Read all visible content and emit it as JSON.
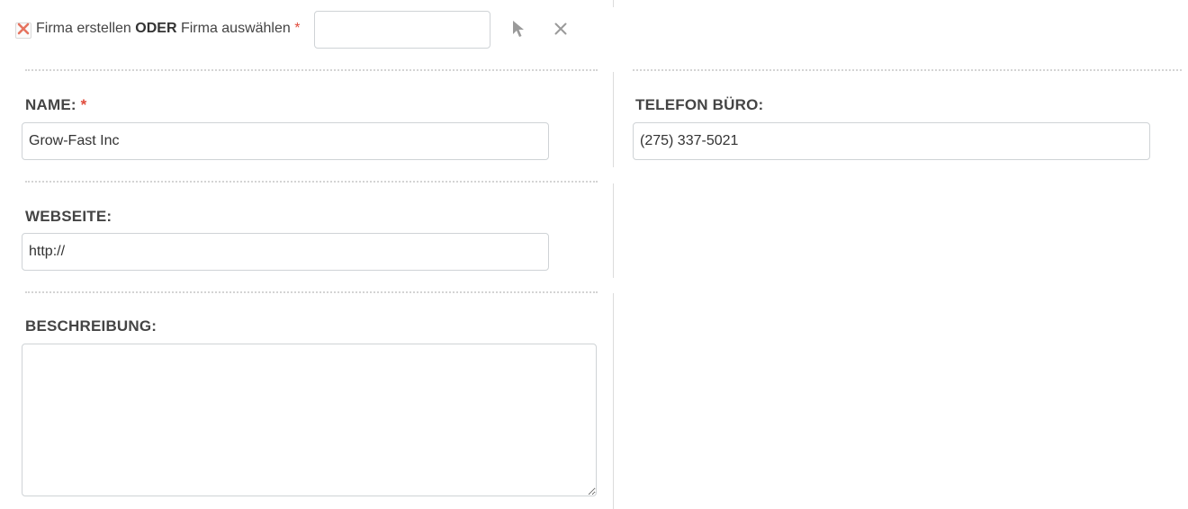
{
  "company": {
    "label_part1": "Firma erstellen",
    "label_or": "ODER",
    "label_part2": "Firma auswählen",
    "required_mark": "*",
    "value": ""
  },
  "fields": {
    "name": {
      "label": "NAME:",
      "required_mark": "*",
      "value": "Grow-Fast Inc"
    },
    "phone_office": {
      "label": "TELEFON BÜRO:",
      "value": "(275) 337-5021"
    },
    "website": {
      "label": "WEBSEITE:",
      "value": "http://"
    },
    "description": {
      "label": "BESCHREIBUNG:",
      "value": ""
    }
  },
  "colors": {
    "required": "#e04b3c",
    "remove_x": "#e5735f",
    "icon_gray": "#9a9a9a"
  }
}
